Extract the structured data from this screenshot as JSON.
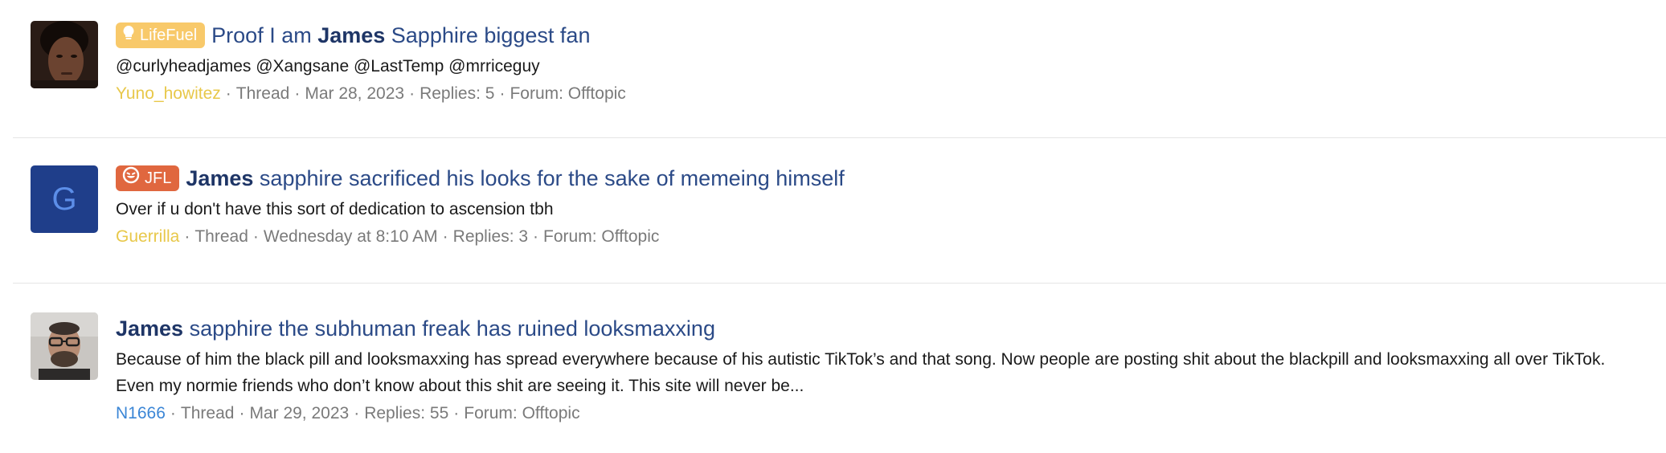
{
  "results": [
    {
      "prefix": "LifeFuel",
      "prefix_icon": "lightbulb-icon",
      "prefix_color": "#f8c96a",
      "title_before": "Proof I am ",
      "title_highlight": "James",
      "title_after": " Sapphire biggest fan",
      "snippet": "@curlyheadjames @Xangsane @LastTemp @mrriceguy",
      "author": "Yuno_howitez",
      "author_color": "#e8c84a",
      "type": "Thread",
      "date": "Mar 28, 2023",
      "replies": "Replies: 5",
      "forum": "Forum: Offtopic"
    },
    {
      "prefix": "JFL",
      "prefix_icon": "laughing-face-icon",
      "prefix_color": "#e0673f",
      "avatar_letter": "G",
      "title_before": "",
      "title_highlight": "James",
      "title_after": " sapphire sacrificed his looks for the sake of memeing himself",
      "snippet": "Over if u don't have this sort of dedication to ascension tbh",
      "author": "Guerrilla",
      "author_color": "#e8c84a",
      "type": "Thread",
      "date": "Wednesday at 8:10 AM",
      "replies": "Replies: 3",
      "forum": "Forum: Offtopic"
    },
    {
      "title_before": "",
      "title_highlight": "James",
      "title_after": " sapphire the subhuman freak has ruined looksmaxxing",
      "snippet": "Because of him the black pill and looksmaxxing has spread everywhere because of his autistic TikTok’s and that song. Now people are posting shit about the blackpill and looksmaxxing all over TikTok. Even my normie friends who don’t know about this shit are seeing it. This site will never be...",
      "author": "N1666",
      "author_color": "#3b86d6",
      "type": "Thread",
      "date": "Mar 29, 2023",
      "replies": "Replies: 55",
      "forum": "Forum: Offtopic"
    }
  ],
  "meta_separator": "·"
}
